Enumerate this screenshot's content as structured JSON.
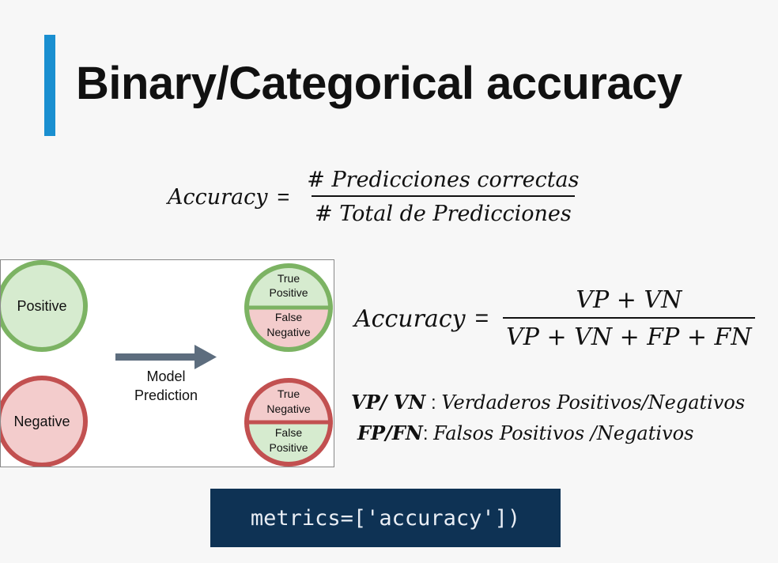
{
  "slide": {
    "title": "Binary/Categorical accuracy",
    "formula1": {
      "lhs": "Accuracy",
      "eq": "=",
      "numerator": "# Predicciones correctas",
      "denominator": "# Total de Predicciones"
    },
    "formula2": {
      "lhs": "Accuracy",
      "eq": "=",
      "numerator": "VP + VN",
      "denominator": "VP + VN + FP + FN"
    },
    "legend": [
      {
        "term": "VP/ VN",
        "sep": " : ",
        "desc": "Verdaderos Positivos/Negativos"
      },
      {
        "term": "FP/FN",
        "sep": ": ",
        "desc": "Falsos Positivos /Negativos"
      }
    ],
    "code": "metrics=['accuracy'])"
  },
  "diagram": {
    "actual_positive": "Positive",
    "actual_negative": "Negative",
    "arrow_label_line1": "Model",
    "arrow_label_line2": "Prediction",
    "pos_top_line1": "True",
    "pos_top_line2": "Positive",
    "pos_bottom_line1": "False",
    "pos_bottom_line2": "Negative",
    "neg_top_line1": "True",
    "neg_top_line2": "Negative",
    "neg_bottom_line1": "False",
    "neg_bottom_line2": "Positive"
  },
  "colors": {
    "accent": "#1a8fd0",
    "positive_fill": "#d6ebcf",
    "positive_stroke": "#7cb363",
    "negative_fill": "#f3cccc",
    "negative_stroke": "#c25050",
    "arrow": "#5d6d7e",
    "code_bg": "#0e3254"
  }
}
